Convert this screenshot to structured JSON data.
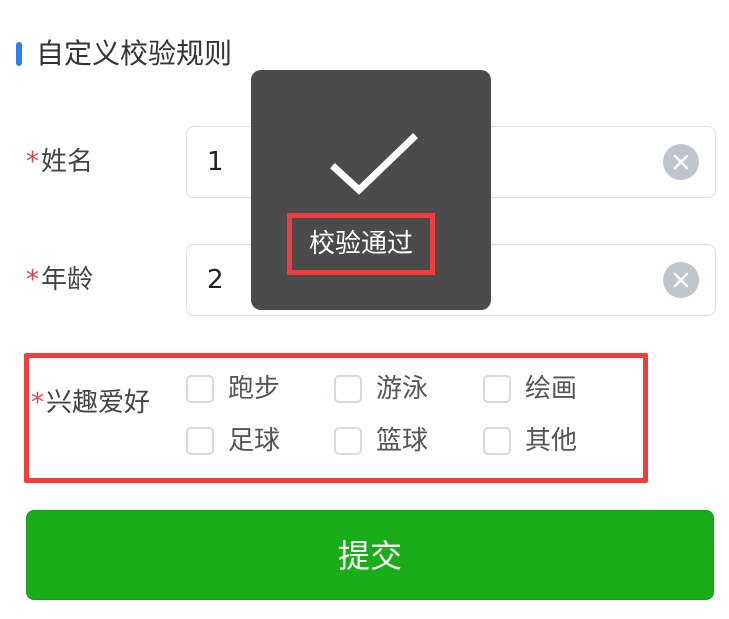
{
  "section": {
    "title": "自定义校验规则"
  },
  "form": {
    "required_mark": "*",
    "fields": [
      {
        "label": "姓名",
        "value": "1"
      },
      {
        "label": "年龄",
        "value": "2"
      }
    ],
    "hobbies": {
      "label": "兴趣爱好",
      "options": [
        "跑步",
        "游泳",
        "绘画",
        "足球",
        "篮球",
        "其他"
      ]
    },
    "submit_label": "提交"
  },
  "toast": {
    "message": "校验通过",
    "icon": "check-icon"
  },
  "colors": {
    "accent": "#2f7cf6",
    "success": "#1aad19",
    "required": "#e64340",
    "highlight": "#f03e3e",
    "toast_bg": "#4b4b4b"
  }
}
